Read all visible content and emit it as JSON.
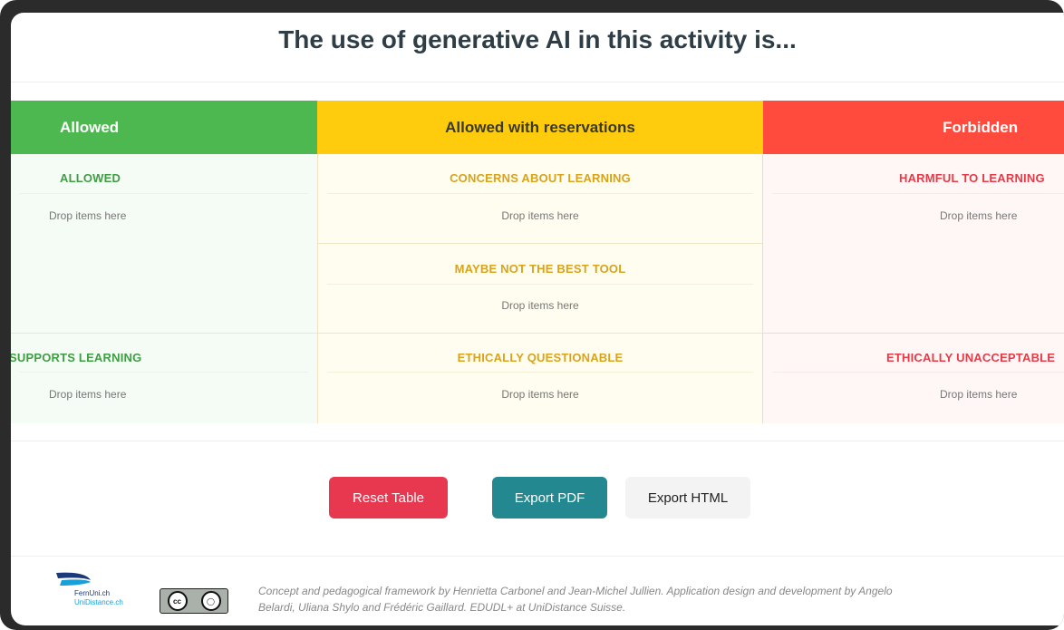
{
  "title": "The use of generative AI in this activity is...",
  "columns": {
    "allowed": {
      "label": "Allowed",
      "color": "#4cb84f"
    },
    "reservations": {
      "label": "Allowed with reservations",
      "color": "#fecc0c"
    },
    "forbidden": {
      "label": "Forbidden",
      "color": "#ff4b3e"
    }
  },
  "cells": {
    "allowed": {
      "title": "ALLOWED",
      "drop": "Drop items here"
    },
    "supports_learning": {
      "title": "SUPPORTS LEARNING",
      "drop": "Drop items here"
    },
    "concerns_learning": {
      "title": "CONCERNS ABOUT LEARNING",
      "drop": "Drop items here"
    },
    "maybe_not_best": {
      "title": "MAYBE NOT THE BEST TOOL",
      "drop": "Drop items here"
    },
    "ethically_questionable": {
      "title": "ETHICALLY QUESTIONABLE",
      "drop": "Drop items here"
    },
    "harmful_learning": {
      "title": "HARMFUL TO LEARNING",
      "drop": "Drop items here"
    },
    "ethically_unacceptable": {
      "title": "ETHICALLY UNACCEPTABLE",
      "drop": "Drop items here"
    }
  },
  "buttons": {
    "reset": "Reset Table",
    "export_pdf": "Export PDF",
    "export_html": "Export HTML"
  },
  "footer": {
    "logo_line1": "FernUni.ch",
    "logo_line2": "UniDistance.ch",
    "license_badge": "cc by",
    "credits": "Concept and pedagogical framework by Henrietta Carbonel and Jean-Michel Jullien. Application design and development by Angelo Belardi, Uliana Shylo and Frédéric Gaillard. EDUDL+ at UniDistance Suisse."
  }
}
